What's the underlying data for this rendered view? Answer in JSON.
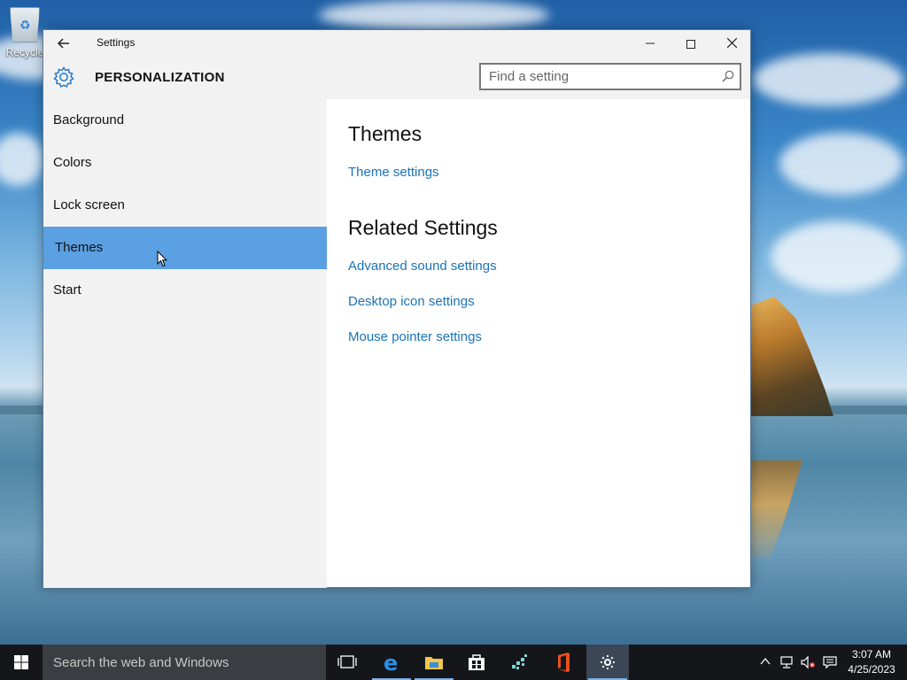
{
  "desktop": {
    "recycle_bin_label": "Recycle"
  },
  "window": {
    "title": "Settings",
    "back_icon": "back-arrow-icon",
    "minimize_glyph": "—",
    "close_glyph": "✕"
  },
  "header": {
    "icon": "gear-icon",
    "title": "PERSONALIZATION",
    "search_placeholder": "Find a setting"
  },
  "sidebar": {
    "items": [
      {
        "label": "Background",
        "selected": false
      },
      {
        "label": "Colors",
        "selected": false
      },
      {
        "label": "Lock screen",
        "selected": false
      },
      {
        "label": "Themes",
        "selected": true
      },
      {
        "label": "Start",
        "selected": false
      }
    ]
  },
  "content": {
    "heading": "Themes",
    "theme_settings_link": "Theme settings",
    "related_heading": "Related Settings",
    "related_links": [
      "Advanced sound settings",
      "Desktop icon settings",
      "Mouse pointer settings"
    ]
  },
  "taskbar": {
    "search_text": "Search the web and Windows",
    "apps": [
      "task-view-icon",
      "edge-icon",
      "file-explorer-icon",
      "store-icon",
      "app-icon",
      "office-icon",
      "settings-icon"
    ],
    "time": "3:07 AM",
    "date": "4/25/2023"
  },
  "colors": {
    "accent": "#5aa0e2",
    "link": "#1a73b8",
    "sidebar_bg": "#f2f2f2",
    "taskbar_bg": "#14161a"
  }
}
